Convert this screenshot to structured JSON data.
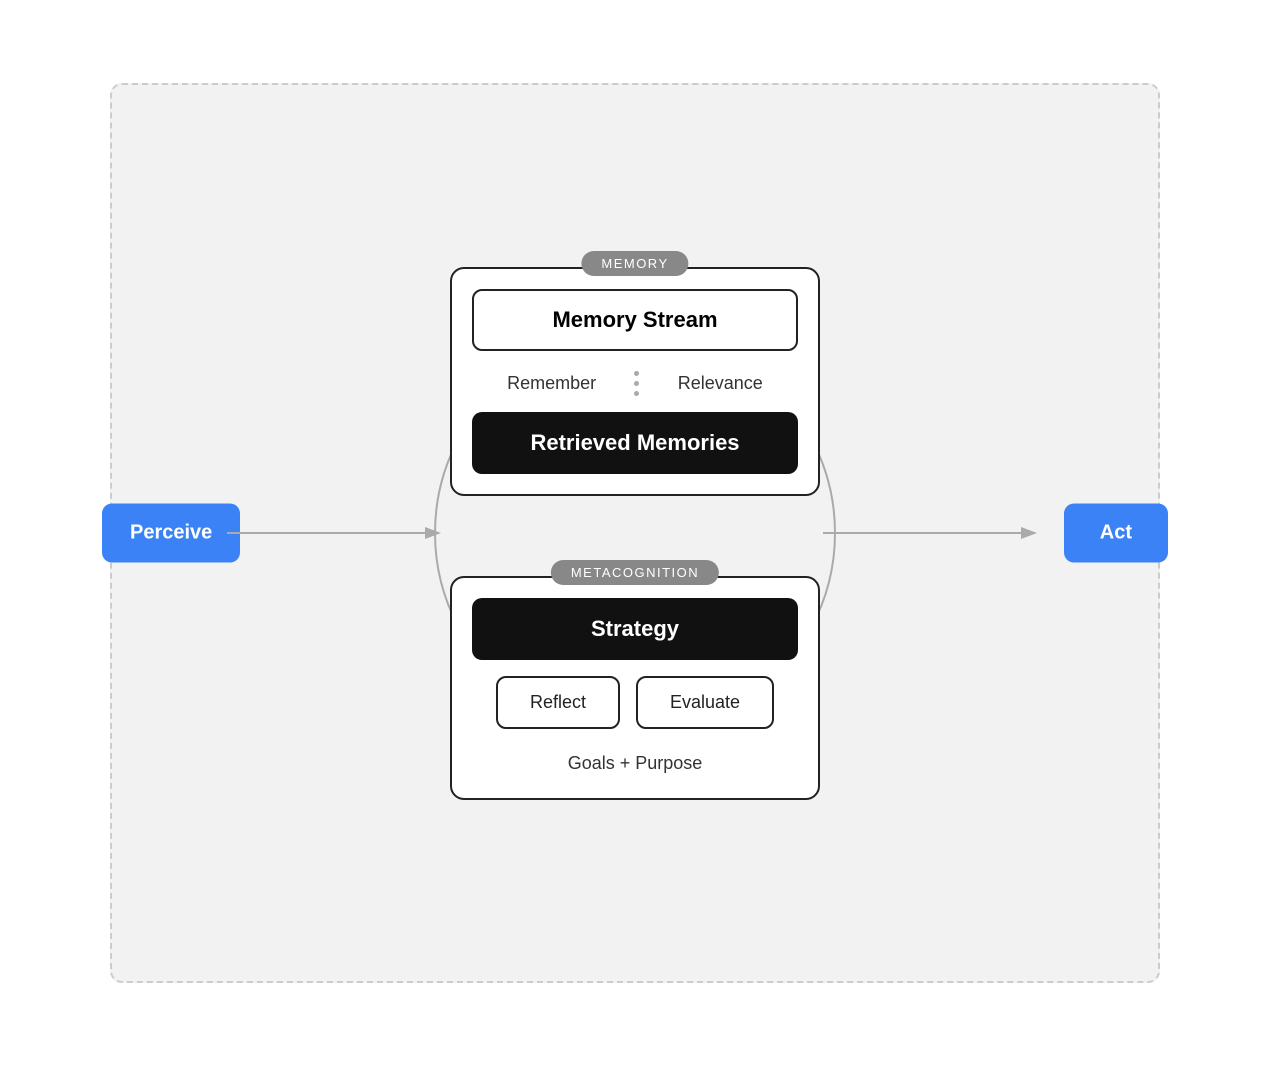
{
  "perceive": {
    "label": "Perceive"
  },
  "act": {
    "label": "Act"
  },
  "memory_card": {
    "label": "MEMORY",
    "memory_stream": "Memory Stream",
    "remember": "Remember",
    "relevance": "Relevance",
    "retrieved_memories": "Retrieved Memories"
  },
  "metacognition_card": {
    "label": "METACOGNITION",
    "strategy": "Strategy",
    "reflect": "Reflect",
    "evaluate": "Evaluate",
    "goals": "Goals + Purpose"
  }
}
